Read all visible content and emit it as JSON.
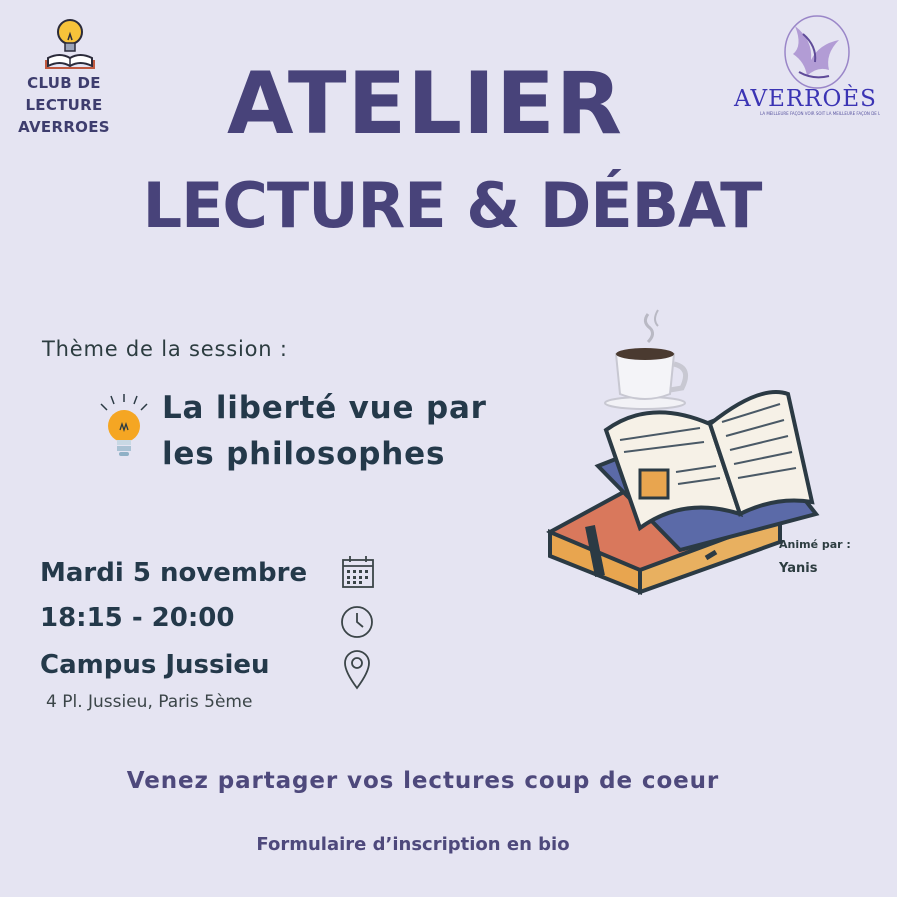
{
  "header": {
    "club_name_line1": "CLUB DE",
    "club_name_line2": "LECTURE",
    "club_name_line3": "AVERROES",
    "title": "ATELIER",
    "subtitle": "LECTURE & DÉBAT",
    "partner_logo_text": "AVERROÈS",
    "partner_logo_tagline": "LA MEILLEURE FAÇON VOIR SOIT LA MEILLEURE FAÇON DE LIRE"
  },
  "session": {
    "theme_label": "Thème de la session :",
    "theme_line1": "La liberté vue par",
    "theme_line2": "les philosophes",
    "animated_by_label": "Animé par :",
    "animator": "Yanis"
  },
  "details": {
    "date": "Mardi 5 novembre",
    "time": "18:15 - 20:00",
    "place": "Campus Jussieu",
    "address": "4 Pl. Jussieu, Paris 5ème"
  },
  "footer": {
    "tagline": "Venez partager vos lectures coup de coeur",
    "signup": "Formulaire d’inscription en bio"
  },
  "colors": {
    "background": "#e5e4f2",
    "title": "#48437a",
    "text_dark": "#24394a",
    "accent_purple": "#4e497c",
    "partner_blue": "#3b34b4"
  },
  "icons": [
    "lightbulb-book-icon",
    "averroes-bird-logo",
    "lightbulb-icon",
    "books-coffee-illustration",
    "calendar-icon",
    "clock-icon",
    "location-pin-icon"
  ]
}
